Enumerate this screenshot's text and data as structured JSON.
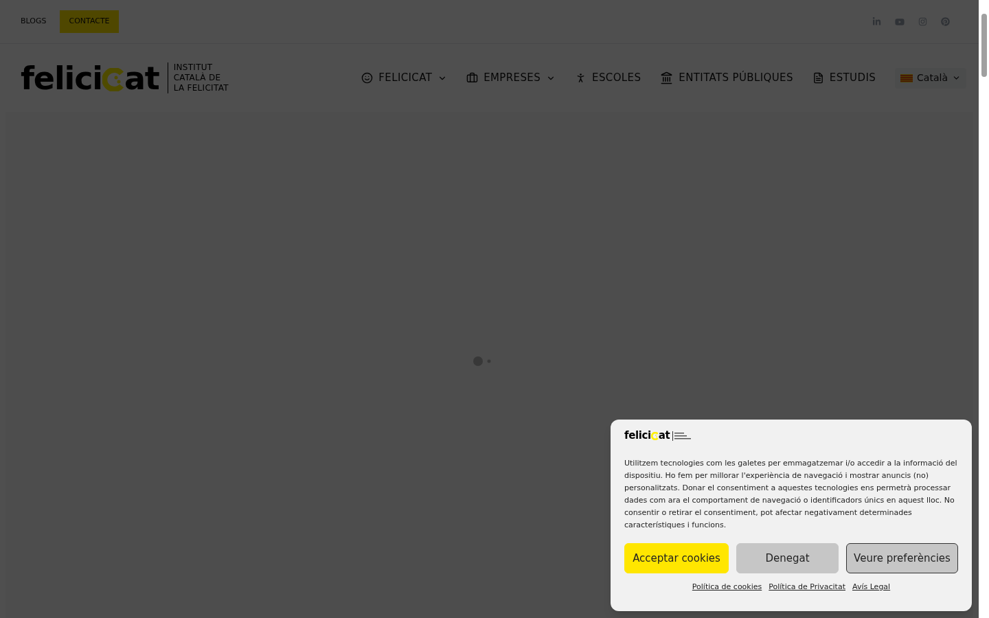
{
  "top_bar": {
    "links": [
      {
        "label": "BLOGS",
        "kind": "plain"
      },
      {
        "label": "CONTACTE",
        "kind": "highlight"
      }
    ],
    "social": [
      {
        "kind": "linkedin"
      },
      {
        "kind": "youtube"
      },
      {
        "kind": "instagram"
      },
      {
        "kind": "pinterest"
      }
    ]
  },
  "logo": {
    "word_start": "felici",
    "word_end": "at",
    "tagline": [
      "INSTITUT",
      "CATALÀ DE",
      "LA FELICITAT"
    ]
  },
  "nav": [
    {
      "label": "FELICICAT",
      "has_menu": true
    },
    {
      "label": "EMPRESES",
      "has_menu": true
    },
    {
      "label": "ESCOLES",
      "has_menu": false
    },
    {
      "label": "ENTITATS PÚBLIQUES",
      "has_menu": false
    },
    {
      "label": "ESTUDIS",
      "has_menu": false
    }
  ],
  "language": {
    "label": "Català",
    "has_menu": true
  },
  "cookie_dialog": {
    "logo": {
      "word_start": "felici",
      "word_end": "at"
    },
    "message": "Utilitzem tecnologies com les galetes per emmagatzemar i/o accedir a la informació del dispositiu. Ho fem per millorar l'experiència de navegació i mostrar anuncis (no) personalitzats. Donar el consentiment a aquestes tecnologies ens permetrà processar dades com ara el comportament de navegació o identificadors únics en aquest lloc. No consentir o retirar el consentiment, pot afectar negativament determinades característiques i funcions.",
    "buttons": [
      {
        "label": "Acceptar cookies",
        "kind": "accept"
      },
      {
        "label": "Denegat",
        "kind": "deny"
      },
      {
        "label": "Veure preferències",
        "kind": "preferences"
      }
    ],
    "links": [
      "Política de cookies",
      "Política de Privacitat",
      "Avís Legal"
    ]
  }
}
